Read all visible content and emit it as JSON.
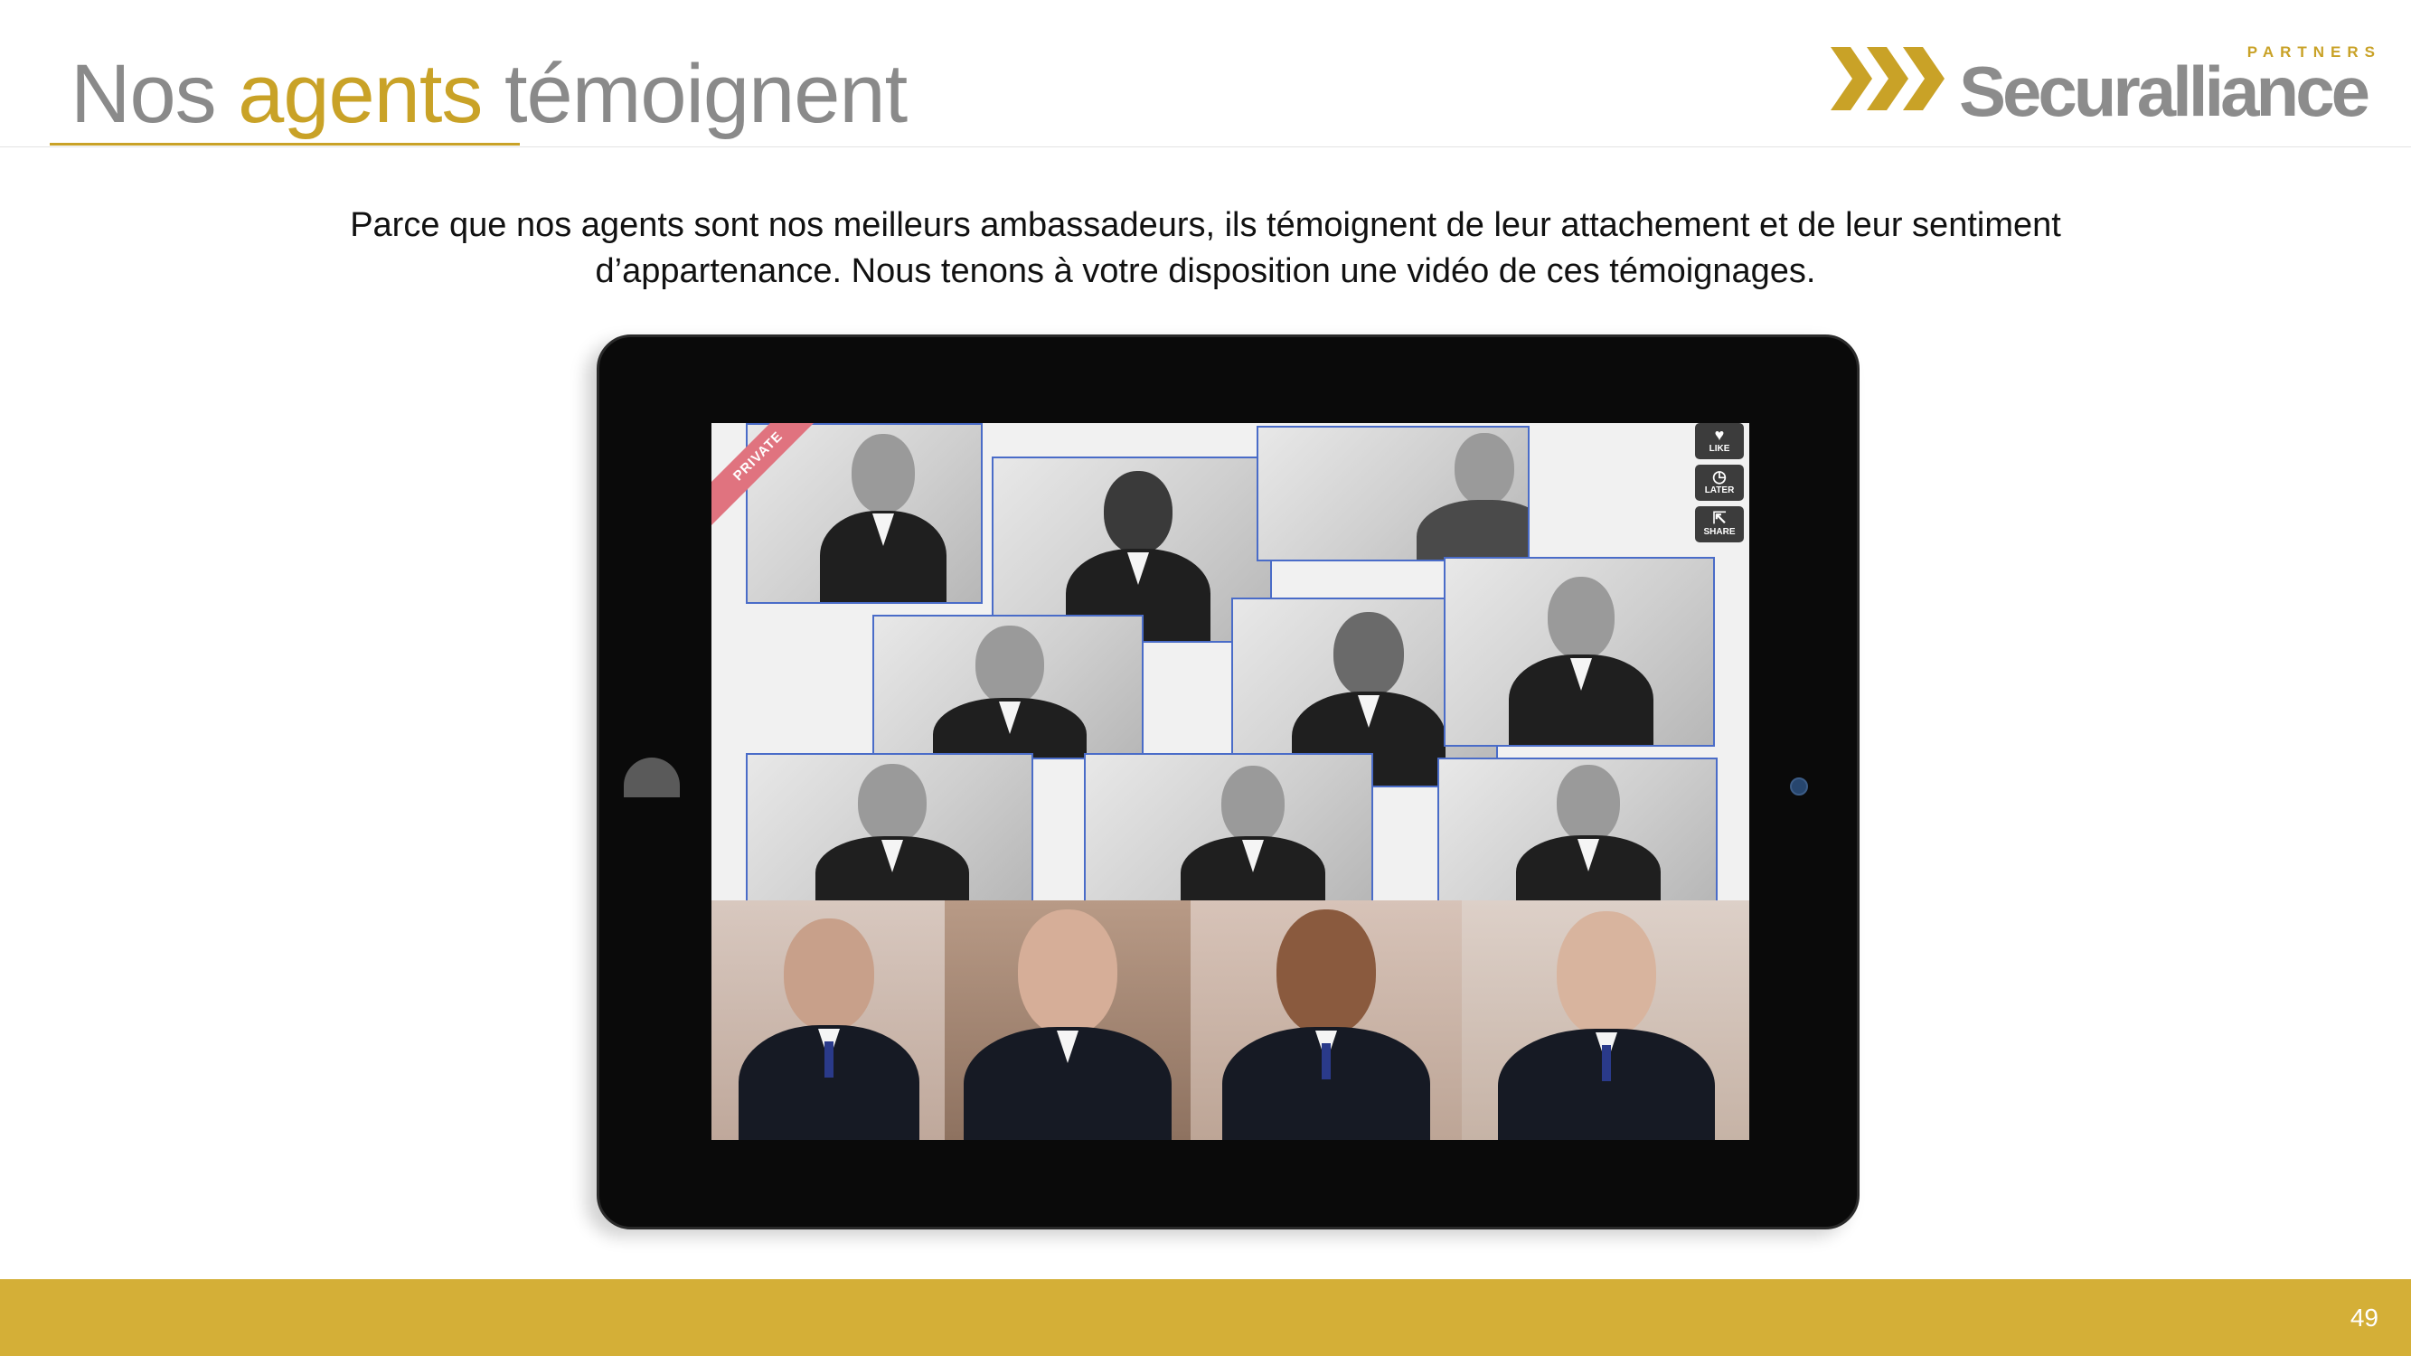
{
  "header": {
    "title_part1": "Nos ",
    "title_accent": "agents",
    "title_part2": " témoignent"
  },
  "logo": {
    "brand": "Securalliance",
    "tagline": "PARTNERS",
    "icon": "triple-chevron-logo-icon"
  },
  "intro": {
    "line1": "Parce que nos agents sont nos meilleurs ambassadeurs, ils témoignent de leur attachement et de leur sentiment",
    "line2": "d’appartenance. Nous tenons à votre disposition une vidéo de ces témoignages."
  },
  "video": {
    "badge": "PRIVATE",
    "actions": [
      {
        "label": "LIKE",
        "icon": "heart-icon"
      },
      {
        "label": "LATER",
        "icon": "clock-icon"
      },
      {
        "label": "SHARE",
        "icon": "share-icon"
      }
    ]
  },
  "colors": {
    "accent": "#c9a227",
    "footer": "#d4af37",
    "title_gray": "#8a8a8a"
  },
  "footer": {
    "page_number": "49"
  }
}
